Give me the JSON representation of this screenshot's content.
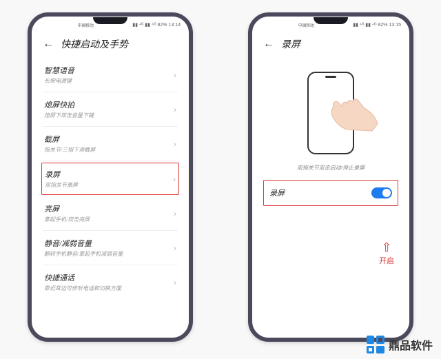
{
  "statusbar": {
    "carrier": "中国移动",
    "signal_icons": "▮▮ ⁴ᴳ ▮▮ ⁴ᴳ",
    "battery": "82%",
    "time_left": "13:14",
    "time_right": "13:15"
  },
  "left": {
    "title": "快捷启动及手势",
    "items": [
      {
        "title": "智慧语音",
        "desc": "长按电源键"
      },
      {
        "title": "熄屏快拍",
        "desc": "熄屏下双击音量下键"
      },
      {
        "title": "截屏",
        "desc": "指关节/三指下滑截屏"
      },
      {
        "title": "录屏",
        "desc": "双指关节录屏",
        "highlight": true
      },
      {
        "title": "亮屏",
        "desc": "拿起手机/双击亮屏"
      },
      {
        "title": "静音/减弱音量",
        "desc": "翻转手机静音/拿起手机减弱音量"
      },
      {
        "title": "快捷通话",
        "desc": "靠近耳边可修听电话和切换方面"
      }
    ]
  },
  "right": {
    "title": "录屏",
    "caption": "双指关节双击启动/停止录屏",
    "toggle_label": "录屏",
    "toggle_on": true,
    "open_label": "开启"
  },
  "watermark": "鼎品软件"
}
